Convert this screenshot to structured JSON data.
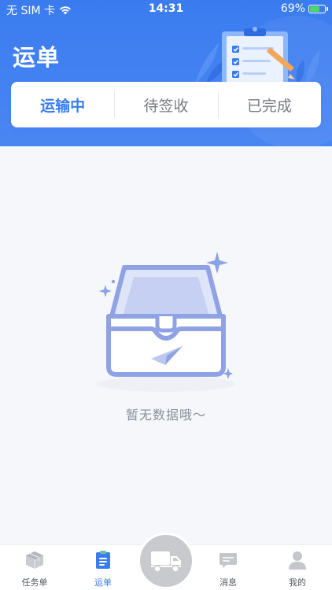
{
  "status_bar": {
    "carrier": "无 SIM 卡",
    "time": "14:31",
    "battery_percent": "69%",
    "battery_level": 0.69,
    "wifi_icon": "wifi-icon"
  },
  "header": {
    "title": "运单",
    "illustration": "clipboard-checklist-icon"
  },
  "tabs": [
    {
      "label": "运输中",
      "active": true
    },
    {
      "label": "待签收",
      "active": false
    },
    {
      "label": "已完成",
      "active": false
    }
  ],
  "empty_state": {
    "message": "暂无数据哦～",
    "icon": "empty-inbox-icon"
  },
  "tabbar": {
    "items": [
      {
        "label": "任务单",
        "icon": "box-icon",
        "active": false
      },
      {
        "label": "运单",
        "icon": "document-icon",
        "active": true
      },
      {
        "label": "消息",
        "icon": "message-icon",
        "active": false
      },
      {
        "label": "我的",
        "icon": "user-icon",
        "active": false
      }
    ],
    "center_button_icon": "truck-icon"
  },
  "colors": {
    "primary": "#3a7cf0",
    "background": "#f6f7fb",
    "inactive_text": "#777a80",
    "fab_gray": "#c9cacd"
  }
}
